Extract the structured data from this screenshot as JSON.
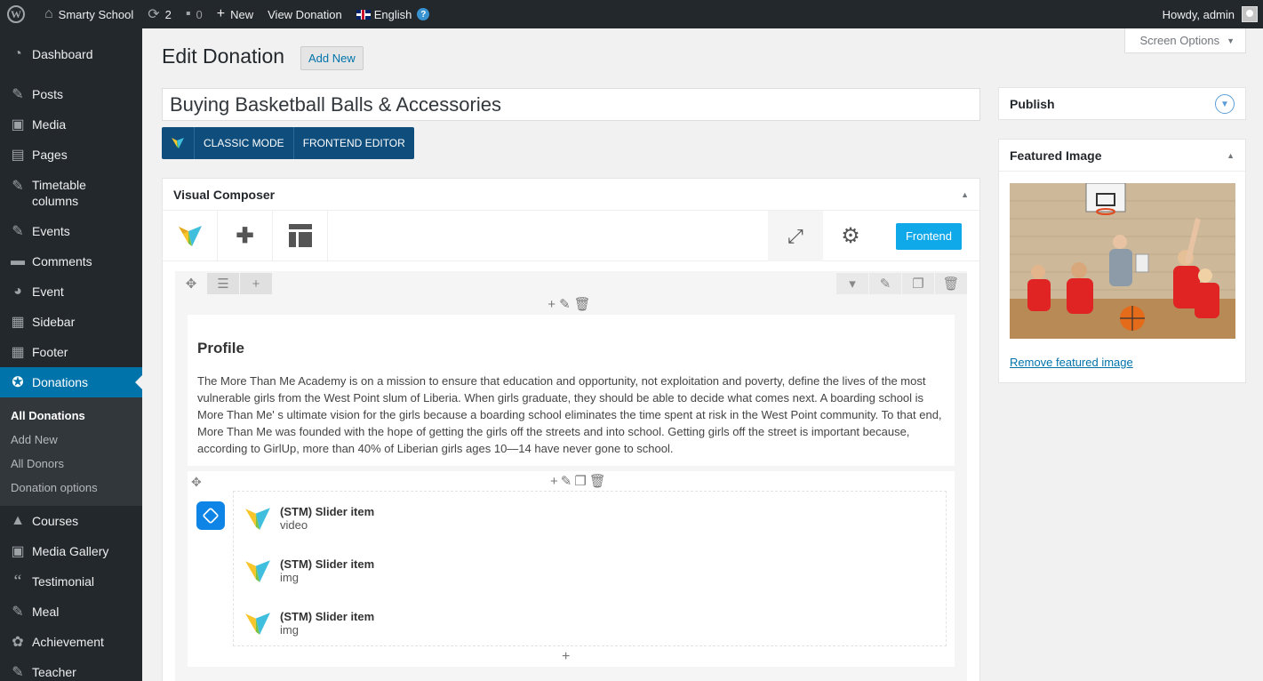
{
  "adminbar": {
    "site_name": "Smarty School",
    "updates_count": "2",
    "comments_count": "0",
    "new_label": "New",
    "view_label": "View Donation",
    "language": "English",
    "howdy": "Howdy, admin"
  },
  "sidebar": {
    "items": [
      {
        "label": "Dashboard",
        "icon": "dashboard-icon"
      },
      {
        "label": "Posts",
        "icon": "pin-icon"
      },
      {
        "label": "Media",
        "icon": "media-icon"
      },
      {
        "label": "Pages",
        "icon": "pages-icon"
      },
      {
        "label": "Timetable columns",
        "icon": "pin-icon"
      },
      {
        "label": "Events",
        "icon": "pin-icon"
      },
      {
        "label": "Comments",
        "icon": "comment-icon"
      },
      {
        "label": "Event",
        "icon": "palette-icon"
      },
      {
        "label": "Sidebar",
        "icon": "grid-icon"
      },
      {
        "label": "Footer",
        "icon": "grid-icon"
      },
      {
        "label": "Donations",
        "icon": "lifebuoy-icon"
      },
      {
        "label": "Courses",
        "icon": "graduation-icon"
      },
      {
        "label": "Media Gallery",
        "icon": "gallery-icon"
      },
      {
        "label": "Testimonial",
        "icon": "quote-icon"
      },
      {
        "label": "Meal",
        "icon": "pin-icon"
      },
      {
        "label": "Achievement",
        "icon": "award-icon"
      },
      {
        "label": "Teacher",
        "icon": "pin-icon"
      }
    ],
    "submenu": [
      "All Donations",
      "Add New",
      "All Donors",
      "Donation options"
    ]
  },
  "main": {
    "screen_options": "Screen Options",
    "page_title": "Edit Donation",
    "add_new": "Add New",
    "post_title": "Buying Basketball Balls & Accessories",
    "classic_mode": "CLASSIC MODE",
    "frontend_editor": "FRONTEND EDITOR"
  },
  "composer": {
    "title": "Visual Composer",
    "frontend_button": "Frontend",
    "profile_title": "Profile",
    "profile_text": "The More Than Me Academy is on a mission to ensure that education and opportunity, not exploitation and poverty, define the lives of the most vulnerable girls from the West Point slum of Liberia. When girls graduate, they should be able to decide what comes next. A boarding school is More Than Me' s ultimate vision for the girls because a boarding school eliminates the time spent at risk in the West Point community. To that end, More Than Me was founded with the hope of getting the girls off the streets and into school. Getting girls off the street is important because, according to GirlUp, more than 40% of Liberian girls ages 10—14 have never gone to school.",
    "slider_items": [
      {
        "name": "(STM) Slider item",
        "type": "video"
      },
      {
        "name": "(STM) Slider item",
        "type": "img"
      },
      {
        "name": "(STM) Slider item",
        "type": "img"
      }
    ]
  },
  "right": {
    "publish_title": "Publish",
    "featured_title": "Featured Image",
    "remove_link": "Remove featured image"
  },
  "colors": {
    "admin_dark": "#23282d",
    "accent": "#0073aa",
    "vc_blue": "#0e4d7c",
    "frontend_blue": "#0fa8e9"
  }
}
